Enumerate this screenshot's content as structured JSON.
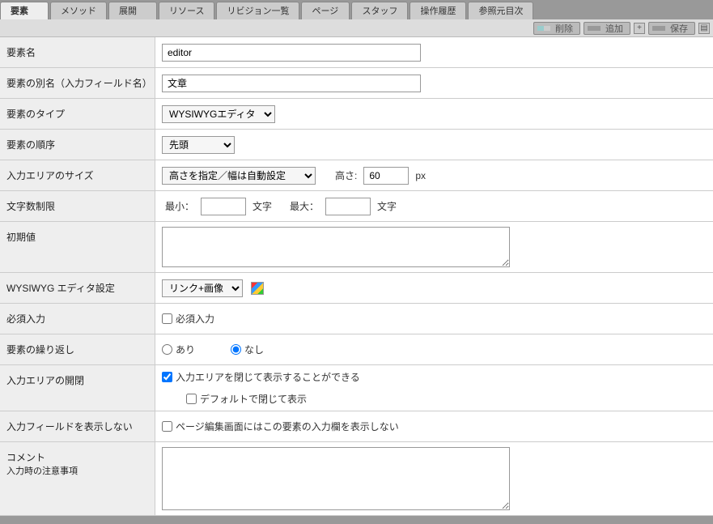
{
  "tabs": [
    "要素",
    "メソッド",
    "展開",
    "リソース",
    "リビジョン一覧",
    "ページ",
    "スタッフ",
    "操作履歴",
    "参照元目次"
  ],
  "activeTab": 0,
  "actions": {
    "delete": "削除",
    "add": "追加",
    "save": "保存"
  },
  "labels": {
    "name": "要素名",
    "alias": "要素の別名（入力フィールド名）",
    "type": "要素のタイプ",
    "order": "要素の順序",
    "areaSize": "入力エリアのサイズ",
    "charLimit": "文字数制限",
    "initial": "初期値",
    "wysiwyg": "WYSIWYG エディタ設定",
    "required": "必須入力",
    "repeat": "要素の繰り返し",
    "collapse": "入力エリアの開閉",
    "hideField": "入力フィールドを表示しない",
    "comment": "コメント",
    "commentSub": "入力時の注意事項"
  },
  "fields": {
    "name": "editor",
    "alias": "文章",
    "type": "WYSIWYGエディタ",
    "order": "先頭",
    "sizeMode": "高さを指定／幅は自動設定",
    "heightLabel": "高さ:",
    "heightValue": "60",
    "heightUnit": "px",
    "minLabel": "最小：",
    "maxLabel": "最大：",
    "minValue": "",
    "maxValue": "",
    "charUnit": "文字",
    "initial": "",
    "wysiwygMode": "リンク+画像",
    "requiredOpt": "必須入力",
    "requiredChecked": false,
    "repeatYes": "あり",
    "repeatNo": "なし",
    "repeatValue": "no",
    "collapseOpt": "入力エリアを閉じて表示することができる",
    "collapseChecked": true,
    "collapseDefault": "デフォルトで閉じて表示",
    "collapseDefaultChecked": false,
    "hideOpt": "ページ編集画面にはこの要素の入力欄を表示しない",
    "hideChecked": false,
    "comment": ""
  }
}
